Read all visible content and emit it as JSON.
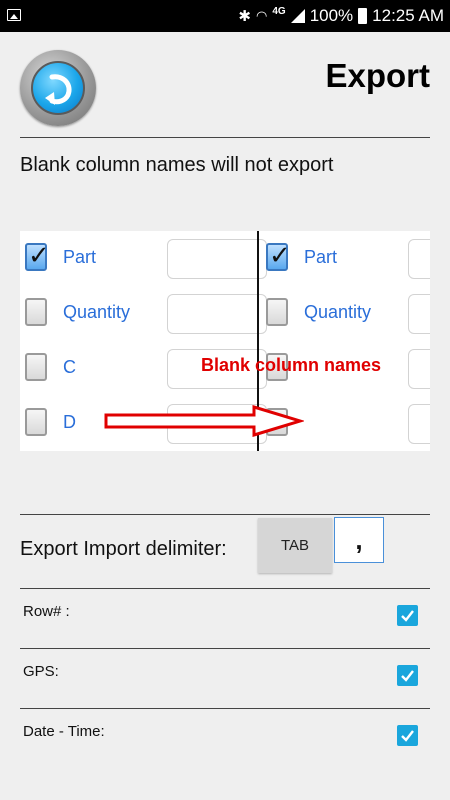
{
  "status_bar": {
    "network": "4G",
    "battery": "100%",
    "time": "12:25 AM"
  },
  "header": {
    "title": "Export",
    "back_icon": "back-arrow-icon"
  },
  "hint_text": "Blank column names will not export",
  "sample_image": {
    "left_rows": [
      "Part",
      "Quantity",
      "C",
      "D"
    ],
    "right_rows": [
      "Part",
      "Quantity"
    ],
    "note": "Blank column names",
    "note_color": "#e00000"
  },
  "delimiter": {
    "label": "Export Import delimiter:",
    "tab_button": "TAB",
    "value": ","
  },
  "options": [
    {
      "label": "Row# :",
      "checked": true
    },
    {
      "label": "GPS:",
      "checked": true
    },
    {
      "label": "Date - Time:",
      "checked": true
    }
  ],
  "colors": {
    "checkbox_accent": "#1aa6dc",
    "link_blue": "#2a6ed9"
  }
}
